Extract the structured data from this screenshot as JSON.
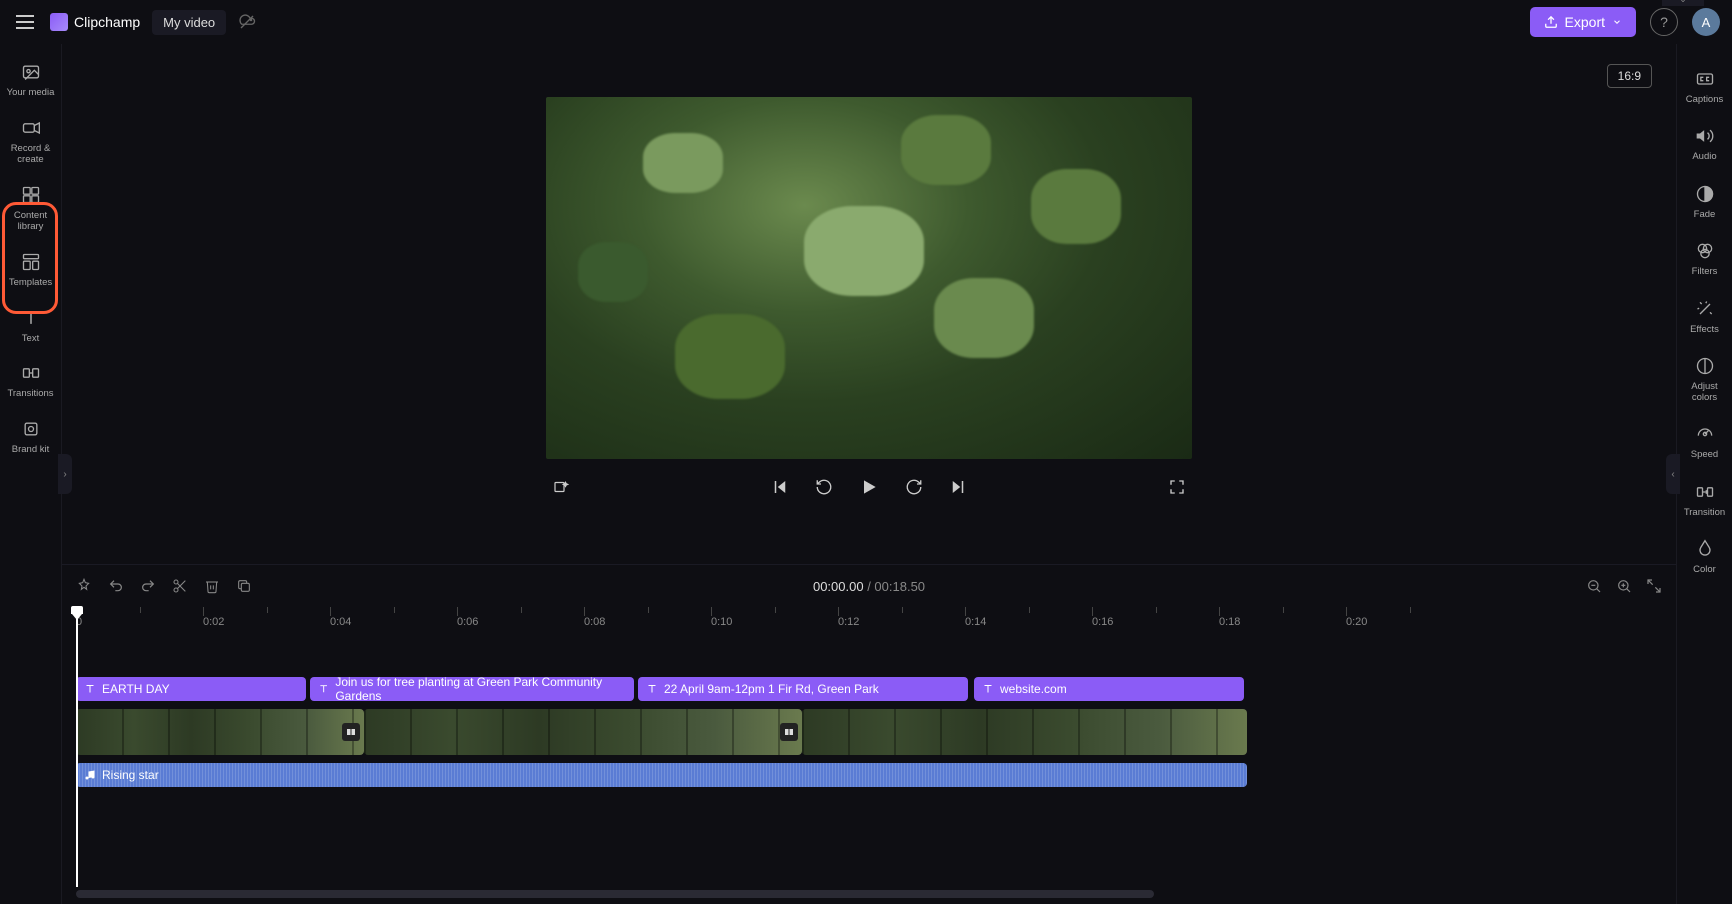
{
  "app": {
    "name": "Clipchamp",
    "project": "My video"
  },
  "export": {
    "label": "Export"
  },
  "avatar": {
    "initial": "A"
  },
  "aspect": {
    "label": "16:9"
  },
  "left_sidebar": {
    "items": [
      {
        "label": "Your media"
      },
      {
        "label": "Record & create"
      },
      {
        "label": "Content library"
      },
      {
        "label": "Templates"
      },
      {
        "label": "Text"
      },
      {
        "label": "Transitions"
      },
      {
        "label": "Brand kit"
      }
    ]
  },
  "right_sidebar": {
    "items": [
      {
        "label": "Captions"
      },
      {
        "label": "Audio"
      },
      {
        "label": "Fade"
      },
      {
        "label": "Filters"
      },
      {
        "label": "Effects"
      },
      {
        "label": "Adjust colors"
      },
      {
        "label": "Speed"
      },
      {
        "label": "Transition"
      },
      {
        "label": "Color"
      }
    ]
  },
  "playback": {
    "current": "00:00.00",
    "duration": "00:18.50"
  },
  "ruler": {
    "labels": [
      "0",
      "0:02",
      "0:04",
      "0:06",
      "0:08",
      "0:10",
      "0:12",
      "0:14",
      "0:16",
      "0:18",
      "0:20"
    ]
  },
  "tracks": {
    "text_clips": [
      {
        "label": "EARTH DAY",
        "start": 0,
        "end": 230
      },
      {
        "label": "Join us for tree planting at Green Park Community Gardens",
        "start": 234,
        "end": 558
      },
      {
        "label": "22 April 9am-12pm 1 Fir Rd, Green Park",
        "start": 562,
        "end": 892
      },
      {
        "label": "website.com",
        "start": 898,
        "end": 1168
      }
    ],
    "video_clips": [
      {
        "start": 0,
        "end": 288
      },
      {
        "start": 288,
        "end": 726
      },
      {
        "start": 726,
        "end": 1171
      }
    ],
    "audio_clip": {
      "label": "Rising star",
      "start": 0,
      "end": 1171
    }
  }
}
